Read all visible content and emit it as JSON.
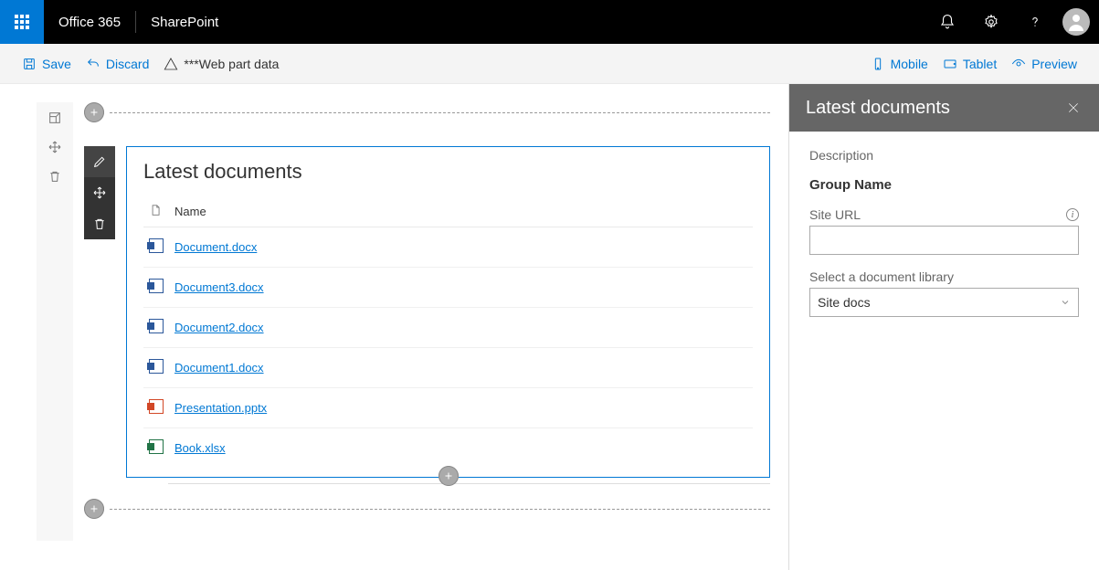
{
  "suite": {
    "brand": "Office 365",
    "app": "SharePoint"
  },
  "commands": {
    "save": "Save",
    "discard": "Discard",
    "breadcrumb": "***Web part data",
    "mobile": "Mobile",
    "tablet": "Tablet",
    "preview": "Preview"
  },
  "webpart": {
    "title": "Latest documents",
    "name_header": "Name",
    "docs": [
      {
        "name": "Document.docx",
        "type": "word"
      },
      {
        "name": "Document3.docx",
        "type": "word"
      },
      {
        "name": "Document2.docx",
        "type": "word"
      },
      {
        "name": "Document1.docx",
        "type": "word"
      },
      {
        "name": "Presentation.pptx",
        "type": "ppt"
      },
      {
        "name": "Book.xlsx",
        "type": "xls"
      }
    ]
  },
  "panel": {
    "title": "Latest documents",
    "description_label": "Description",
    "group_name": "Group Name",
    "site_url_label": "Site URL",
    "site_url_value": "",
    "library_label": "Select a document library",
    "library_value": "Site docs"
  }
}
